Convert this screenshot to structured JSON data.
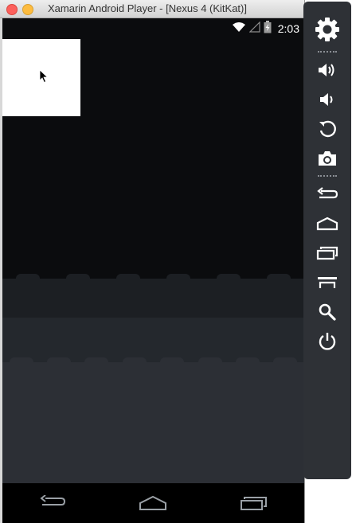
{
  "window": {
    "title": "Xamarin Android Player - [Nexus 4 (KitKat)]"
  },
  "status_bar": {
    "time": "2:03",
    "icons": [
      "wifi-icon",
      "signal-icon",
      "battery-charging-icon"
    ]
  },
  "navigation_bar": {
    "buttons": [
      "back-icon",
      "home-icon",
      "recent-apps-icon"
    ]
  },
  "toolbar": {
    "tools": [
      {
        "name": "settings",
        "icon": "gear-icon"
      },
      {
        "name": "volume-up",
        "icon": "volume-up-icon"
      },
      {
        "name": "volume-down",
        "icon": "volume-down-icon"
      },
      {
        "name": "rotate",
        "icon": "rotate-icon"
      },
      {
        "name": "screenshot",
        "icon": "camera-icon"
      },
      {
        "name": "back",
        "icon": "back-icon"
      },
      {
        "name": "home",
        "icon": "home-icon"
      },
      {
        "name": "recent-apps",
        "icon": "recent-apps-icon"
      },
      {
        "name": "menu",
        "icon": "menu-icon"
      },
      {
        "name": "search",
        "icon": "search-icon"
      },
      {
        "name": "power",
        "icon": "power-icon"
      }
    ]
  },
  "colors": {
    "screen_background": "#0b0c0e",
    "toolbar_background": "#2e3136",
    "icon": "#ffffff"
  }
}
